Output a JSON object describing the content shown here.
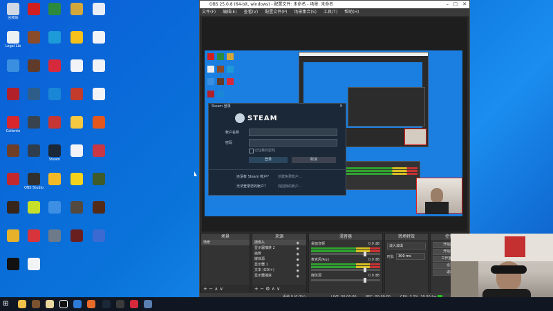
{
  "desktop": {
    "icons": [
      {
        "label": "回收站",
        "color": "#cfd8e3"
      },
      {
        "label": "",
        "color": "#d11f1f"
      },
      {
        "label": "",
        "color": "#2c8a3e"
      },
      {
        "label": "",
        "color": "#d4a73b"
      },
      {
        "label": "",
        "color": "#e9eef4"
      },
      {
        "label": "Legal Lib",
        "color": "#ecf0f3"
      },
      {
        "label": "",
        "color": "#8a4b2b"
      },
      {
        "label": "",
        "color": "#1d9ad8"
      },
      {
        "label": "",
        "color": "#f6c11a"
      },
      {
        "label": "",
        "color": "#f1f3f6"
      },
      {
        "label": "",
        "color": "#3b8fe0"
      },
      {
        "label": "",
        "color": "#603b2a"
      },
      {
        "label": "",
        "color": "#d62a3c"
      },
      {
        "label": "",
        "color": "#f1f3f6"
      },
      {
        "label": "",
        "color": "#f1f3f6"
      },
      {
        "label": "",
        "color": "#b2202a"
      },
      {
        "label": "",
        "color": "#2e5d8a"
      },
      {
        "label": "",
        "color": "#1a86d6"
      },
      {
        "label": "",
        "color": "#c23b2b"
      },
      {
        "label": "",
        "color": "#f1f3f6"
      },
      {
        "label": "Caliente",
        "color": "#d8282d"
      },
      {
        "label": "",
        "color": "#39434f"
      },
      {
        "label": "",
        "color": "#c53634"
      },
      {
        "label": "",
        "color": "#f5c842"
      },
      {
        "label": "",
        "color": "#e4571c"
      },
      {
        "label": "",
        "color": "#6f3e27"
      },
      {
        "label": "",
        "color": "#2f3e4e"
      },
      {
        "label": "Steam",
        "color": "#1b2838"
      },
      {
        "label": "",
        "color": "#f1f3f6"
      },
      {
        "label": "",
        "color": "#c93744"
      },
      {
        "label": "",
        "color": "#c3282d"
      },
      {
        "label": "OBS Studio",
        "color": "#30302f"
      },
      {
        "label": "",
        "color": "#f3b927"
      },
      {
        "label": "",
        "color": "#f3d31c"
      },
      {
        "label": "",
        "color": "#3e5b29"
      },
      {
        "label": "",
        "color": "#37251c"
      },
      {
        "label": "",
        "color": "#c6e02a"
      },
      {
        "label": "",
        "color": "#3d8fe3"
      },
      {
        "label": "",
        "color": "#53493e"
      },
      {
        "label": "",
        "color": "#542b16"
      },
      {
        "label": "",
        "color": "#e8b12a"
      },
      {
        "label": "",
        "color": "#d8343b"
      },
      {
        "label": "",
        "color": "#6d7a8a"
      },
      {
        "label": "",
        "color": "#6a1f1f"
      },
      {
        "label": "",
        "color": "#3b6bd2"
      },
      {
        "label": "",
        "color": "#111111"
      },
      {
        "label": "",
        "color": "#f1f3f6"
      }
    ]
  },
  "obs": {
    "title": "OBS 25.0.8 (64-bit, windows) - 配置文件: 未命名 - 场景: 未命名",
    "menu": [
      "文件(F)",
      "编辑(E)",
      "查看(V)",
      "配置文件(P)",
      "场景集合(S)",
      "工具(T)",
      "帮助(H)"
    ],
    "steam": {
      "window_title": "Steam 登录",
      "logo": "STEAM",
      "account_label": "帐户名称",
      "password_label": "密码",
      "remember": "记住我的密码",
      "login_button": "登录",
      "cancel_button": "取消",
      "no_account": "还没有 Steam 帐户？",
      "create_account": "创建免费帐户...",
      "forgot": "无法登录您的帐户？",
      "retrieve": "找回我的帐户..."
    },
    "docks": {
      "scenes": {
        "title": "场景",
        "items": [
          "场景"
        ]
      },
      "sources": {
        "title": "来源",
        "items": [
          "摄像头",
          "显示器捕获 2",
          "画板",
          "媒体源",
          "显示器 1",
          "文本 (GDI+)",
          "显示器捕获"
        ]
      },
      "mixer": {
        "title": "混音器",
        "channels": [
          {
            "name": "桌面音频",
            "db": "0.0 dB"
          },
          {
            "name": "麦克风/Aux",
            "db": "0.0 dB"
          },
          {
            "name": "媒体源",
            "db": "0.0 dB"
          }
        ]
      },
      "transitions": {
        "title": "转场特效",
        "current": "淡入淡出",
        "duration_label": "时长",
        "duration_value": "300 ms"
      },
      "controls": {
        "title": "控件",
        "buttons": [
          "开始推流",
          "开始录制",
          "工作室模式",
          "设置",
          "退出"
        ]
      }
    },
    "status": {
      "live": "LIVE: 00:00:00",
      "rec": "REC: 00:00:00",
      "cpu": "CPU: 3.2%, 30.00 fps",
      "dropped": "丢帧 0 (0.0%)"
    }
  },
  "colors": {
    "accent_green": "#21c521",
    "accent_red": "#e02020",
    "steam_bg": "#1b2838"
  }
}
